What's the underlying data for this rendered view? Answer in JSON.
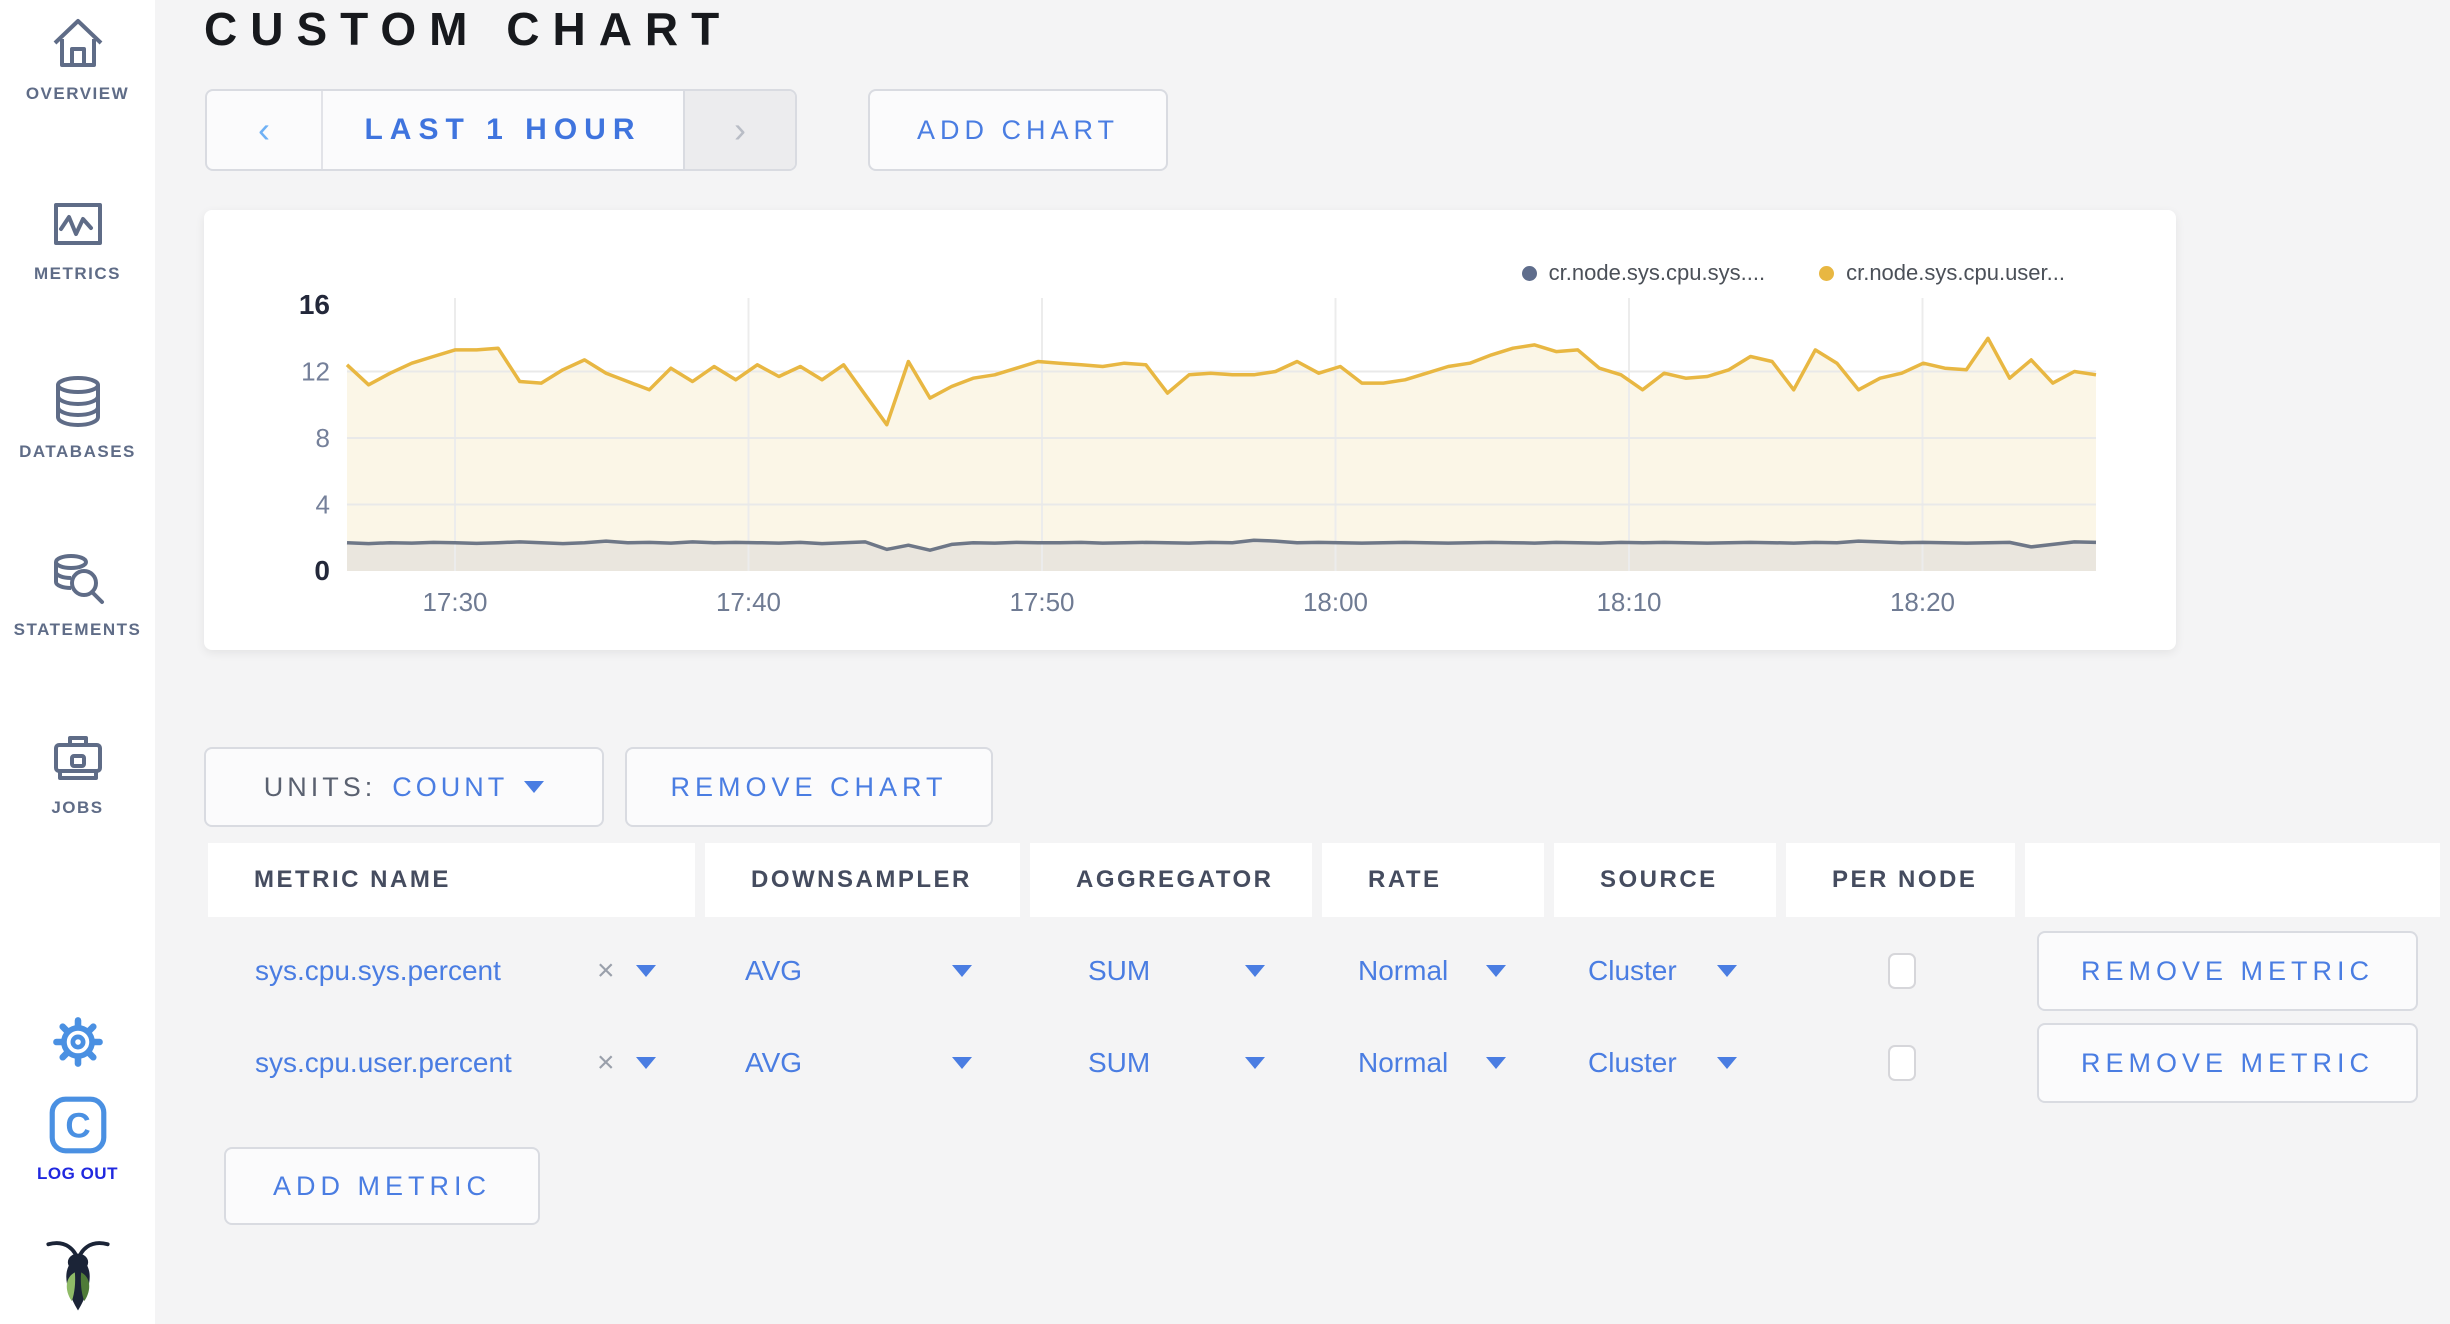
{
  "header": {
    "title": "CUSTOM CHART"
  },
  "sidebar": {
    "items": [
      {
        "id": "overview",
        "label": "OVERVIEW"
      },
      {
        "id": "metrics",
        "label": "METRICS"
      },
      {
        "id": "databases",
        "label": "DATABASES"
      },
      {
        "id": "statements",
        "label": "STATEMENTS"
      },
      {
        "id": "jobs",
        "label": "JOBS"
      }
    ],
    "logout_label": "LOG OUT"
  },
  "controls": {
    "prev": "‹",
    "range": "LAST 1 HOUR",
    "next": "›",
    "add_chart": "ADD CHART"
  },
  "units": {
    "label": "UNITS:",
    "value": "COUNT"
  },
  "actions": {
    "remove_chart": "REMOVE CHART",
    "add_metric": "ADD METRIC"
  },
  "table": {
    "headers": [
      "METRIC NAME",
      "DOWNSAMPLER",
      "AGGREGATOR",
      "RATE",
      "SOURCE",
      "PER NODE"
    ],
    "clear_icon": "×",
    "rows": [
      {
        "name": "sys.cpu.sys.percent",
        "downsampler": "AVG",
        "aggregator": "SUM",
        "rate": "Normal",
        "source": "Cluster",
        "per_node_checked": false,
        "remove_label": "REMOVE METRIC"
      },
      {
        "name": "sys.cpu.user.percent",
        "downsampler": "AVG",
        "aggregator": "SUM",
        "rate": "Normal",
        "source": "Cluster",
        "per_node_checked": false,
        "remove_label": "REMOVE METRIC"
      }
    ]
  },
  "chart_data": {
    "type": "line",
    "title": "",
    "x_ticks": [
      "17:30",
      "17:40",
      "17:50",
      "18:00",
      "18:10",
      "18:20"
    ],
    "y_ticks": [
      0,
      4,
      8,
      12,
      16
    ],
    "ylim": [
      0,
      16
    ],
    "grid": true,
    "legend_position": "top-right",
    "series": [
      {
        "name": "cr.node.sys.cpu.sys....",
        "color": "#6e7787",
        "dot_color": "#5f6d8c",
        "fill": "#eae6de",
        "values": [
          1.7,
          1.65,
          1.7,
          1.68,
          1.72,
          1.7,
          1.66,
          1.7,
          1.75,
          1.7,
          1.65,
          1.7,
          1.8,
          1.7,
          1.72,
          1.68,
          1.75,
          1.7,
          1.72,
          1.7,
          1.68,
          1.72,
          1.65,
          1.7,
          1.75,
          1.3,
          1.55,
          1.25,
          1.6,
          1.7,
          1.68,
          1.72,
          1.7,
          1.7,
          1.72,
          1.68,
          1.7,
          1.72,
          1.7,
          1.68,
          1.72,
          1.7,
          1.85,
          1.8,
          1.7,
          1.72,
          1.7,
          1.68,
          1.7,
          1.72,
          1.7,
          1.68,
          1.7,
          1.72,
          1.7,
          1.68,
          1.72,
          1.7,
          1.68,
          1.72,
          1.7,
          1.72,
          1.7,
          1.68,
          1.7,
          1.72,
          1.7,
          1.68,
          1.72,
          1.7,
          1.8,
          1.75,
          1.7,
          1.72,
          1.7,
          1.68,
          1.7,
          1.72,
          1.45,
          1.6,
          1.75,
          1.72
        ]
      },
      {
        "name": "cr.node.sys.cpu.user...",
        "color": "#e8b742",
        "dot_color": "#e8b742",
        "fill": "#fbf6e7",
        "values": [
          12.4,
          11.2,
          11.9,
          12.5,
          12.9,
          13.3,
          13.3,
          13.4,
          11.4,
          11.3,
          12.1,
          12.7,
          11.9,
          11.4,
          10.9,
          12.2,
          11.4,
          12.3,
          11.5,
          12.4,
          11.7,
          12.3,
          11.5,
          12.4,
          10.6,
          8.8,
          12.6,
          10.4,
          11.1,
          11.6,
          11.8,
          12.2,
          12.6,
          12.5,
          12.4,
          12.3,
          12.5,
          12.4,
          10.7,
          11.8,
          11.9,
          11.8,
          11.8,
          12.0,
          12.6,
          11.9,
          12.3,
          11.3,
          11.3,
          11.5,
          11.9,
          12.3,
          12.5,
          13.0,
          13.4,
          13.6,
          13.2,
          13.3,
          12.2,
          11.8,
          10.9,
          11.9,
          11.6,
          11.7,
          12.1,
          12.9,
          12.6,
          10.9,
          13.3,
          12.5,
          10.9,
          11.6,
          11.9,
          12.5,
          12.2,
          12.1,
          14.0,
          11.6,
          12.7,
          11.3,
          12.0,
          11.8
        ]
      }
    ]
  }
}
